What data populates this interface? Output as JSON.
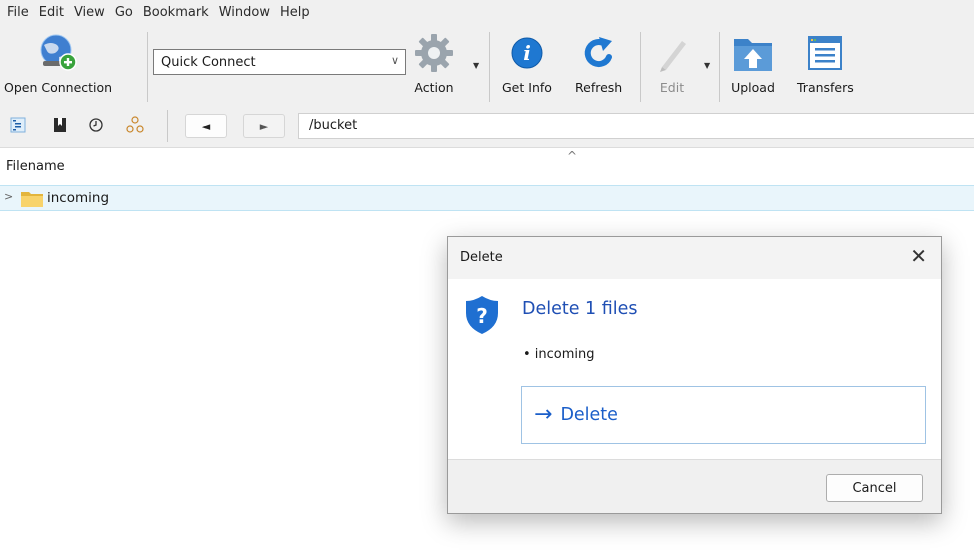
{
  "menu": [
    "File",
    "Edit",
    "View",
    "Go",
    "Bookmark",
    "Window",
    "Help"
  ],
  "toolbar": {
    "open_connection": "Open Connection",
    "quick_connect": "Quick Connect",
    "action": "Action",
    "get_info": "Get Info",
    "refresh": "Refresh",
    "edit": "Edit",
    "upload": "Upload",
    "transfers": "Transfers"
  },
  "nav": {
    "back_glyph": "◄",
    "forward_glyph": "►",
    "path": "/bucket",
    "icons": [
      "browser-view-icon",
      "bookmarks-icon",
      "history-icon",
      "bonjour-icon"
    ]
  },
  "list": {
    "column_filename": "Filename",
    "sort_glyph": "^",
    "rows": [
      {
        "name": "incoming",
        "type": "folder",
        "expander": ">"
      }
    ]
  },
  "dialog": {
    "title": "Delete",
    "close_glyph": "✕",
    "instruction": "Delete 1 files",
    "content": "• incoming",
    "command_arrow": "→",
    "command_label": "Delete",
    "cancel_label": "Cancel"
  },
  "colors": {
    "accent_blue": "#1a5ec9",
    "selected_row": "#e9f5fb",
    "chrome_bg": "#f0f0f0"
  }
}
